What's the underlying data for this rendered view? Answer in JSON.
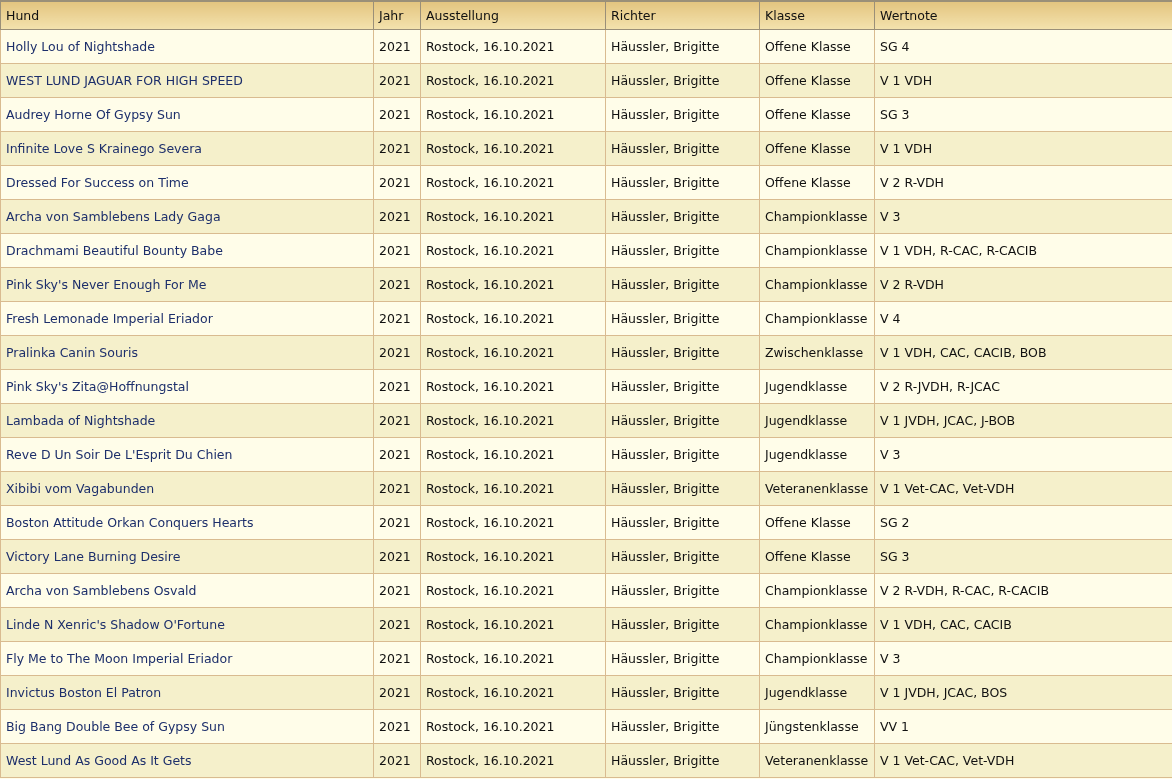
{
  "table": {
    "columns": [
      "Hund",
      "Jahr",
      "Ausstellung",
      "Richter",
      "Klasse",
      "Wertnote"
    ],
    "rows": [
      [
        "Holly Lou of Nightshade",
        "2021",
        "Rostock, 16.10.2021",
        "Häussler, Brigitte",
        "Offene Klasse",
        "SG 4"
      ],
      [
        "WEST LUND JAGUAR FOR HIGH SPEED",
        "2021",
        "Rostock, 16.10.2021",
        "Häussler, Brigitte",
        "Offene Klasse",
        "V 1 VDH"
      ],
      [
        "Audrey Horne Of Gypsy Sun",
        "2021",
        "Rostock, 16.10.2021",
        "Häussler, Brigitte",
        "Offene Klasse",
        "SG 3"
      ],
      [
        "Infinite Love S Krainego Severa",
        "2021",
        "Rostock, 16.10.2021",
        "Häussler, Brigitte",
        "Offene Klasse",
        "V 1 VDH"
      ],
      [
        "Dressed For Success on Time",
        "2021",
        "Rostock, 16.10.2021",
        "Häussler, Brigitte",
        "Offene Klasse",
        "V 2 R-VDH"
      ],
      [
        "Archa von Samblebens Lady Gaga",
        "2021",
        "Rostock, 16.10.2021",
        "Häussler, Brigitte",
        "Championklasse",
        "V 3"
      ],
      [
        "Drachmami Beautiful Bounty Babe",
        "2021",
        "Rostock, 16.10.2021",
        "Häussler, Brigitte",
        "Championklasse",
        "V 1 VDH, R-CAC, R-CACIB"
      ],
      [
        "Pink Sky's Never Enough For Me",
        "2021",
        "Rostock, 16.10.2021",
        "Häussler, Brigitte",
        "Championklasse",
        "V 2 R-VDH"
      ],
      [
        "Fresh Lemonade Imperial Eriador",
        "2021",
        "Rostock, 16.10.2021",
        "Häussler, Brigitte",
        "Championklasse",
        "V 4"
      ],
      [
        "Pralinka Canin Souris",
        "2021",
        "Rostock, 16.10.2021",
        "Häussler, Brigitte",
        "Zwischenklasse",
        "V 1 VDH, CAC, CACIB, BOB"
      ],
      [
        "Pink Sky's Zita@Hoffnungstal",
        "2021",
        "Rostock, 16.10.2021",
        "Häussler, Brigitte",
        "Jugendklasse",
        "V 2 R-JVDH, R-JCAC"
      ],
      [
        "Lambada of Nightshade",
        "2021",
        "Rostock, 16.10.2021",
        "Häussler, Brigitte",
        "Jugendklasse",
        "V 1 JVDH, JCAC, J-BOB"
      ],
      [
        "Reve D Un Soir De L'Esprit Du Chien",
        "2021",
        "Rostock, 16.10.2021",
        "Häussler, Brigitte",
        "Jugendklasse",
        "V 3"
      ],
      [
        "Xibibi vom Vagabunden",
        "2021",
        "Rostock, 16.10.2021",
        "Häussler, Brigitte",
        "Veteranenklasse",
        "V 1 Vet-CAC, Vet-VDH"
      ],
      [
        "Boston Attitude Orkan Conquers Hearts",
        "2021",
        "Rostock, 16.10.2021",
        "Häussler, Brigitte",
        "Offene Klasse",
        "SG 2"
      ],
      [
        "Victory Lane Burning Desire",
        "2021",
        "Rostock, 16.10.2021",
        "Häussler, Brigitte",
        "Offene Klasse",
        "SG 3"
      ],
      [
        "Archa von Samblebens Osvald",
        "2021",
        "Rostock, 16.10.2021",
        "Häussler, Brigitte",
        "Championklasse",
        "V 2 R-VDH, R-CAC, R-CACIB"
      ],
      [
        "Linde N Xenric's Shadow O'Fortune",
        "2021",
        "Rostock, 16.10.2021",
        "Häussler, Brigitte",
        "Championklasse",
        "V 1 VDH, CAC, CACIB"
      ],
      [
        "Fly Me to The Moon Imperial Eriador",
        "2021",
        "Rostock, 16.10.2021",
        "Häussler, Brigitte",
        "Championklasse",
        "V 3"
      ],
      [
        "Invictus Boston El Patron",
        "2021",
        "Rostock, 16.10.2021",
        "Häussler, Brigitte",
        "Jugendklasse",
        "V 1 JVDH, JCAC, BOS"
      ],
      [
        "Big Bang Double Bee of Gypsy Sun",
        "2021",
        "Rostock, 16.10.2021",
        "Häussler, Brigitte",
        "Jüngstenklasse",
        "VV 1"
      ],
      [
        "West Lund As Good As It Gets",
        "2021",
        "Rostock, 16.10.2021",
        "Häussler, Brigitte",
        "Veteranenklasse",
        "V 1 Vet-CAC, Vet-VDH"
      ]
    ]
  }
}
